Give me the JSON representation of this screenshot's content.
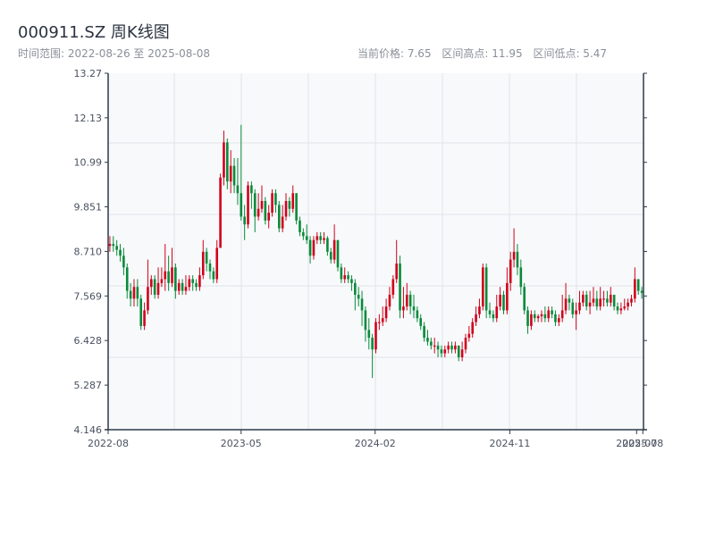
{
  "header": {
    "title": "000911.SZ 周K线图",
    "range_label": "时间范围: 2022-08-26 至 2025-08-08",
    "current_price": "当前价格: 7.65",
    "range_high": "区间高点: 11.95",
    "range_low": "区间低点: 5.47"
  },
  "chart_data": {
    "type": "candlestick",
    "title": "000911.SZ 周K线图",
    "start_date": "2022-08-26",
    "end_date": "2025-08-08",
    "ylim": [
      4.146,
      13.27
    ],
    "yticks": [
      "13.27",
      "12.13",
      "10.99",
      "9.851",
      "8.710",
      "7.569",
      "6.428",
      "5.287",
      "4.146"
    ],
    "xticks": [
      {
        "label": "2022-08",
        "week": 0
      },
      {
        "label": "2023-05",
        "week": 38.5
      },
      {
        "label": "2024-02",
        "week": 77.3
      },
      {
        "label": "2024-11",
        "week": 116.3
      },
      {
        "label": "2025-07",
        "week": 153
      },
      {
        "label": "2025-08",
        "week": 154.8
      }
    ],
    "colors": {
      "up": "#d0021b",
      "down": "#0a8a3a",
      "axis": "#2d3a4a",
      "grid": "#e1e4e8",
      "bg": "#f7f9fb"
    },
    "open": [
      8.85,
      8.9,
      8.85,
      8.75,
      8.6,
      8.3,
      7.7,
      7.5,
      7.8,
      7.5,
      6.8,
      7.2,
      7.8,
      8.0,
      7.6,
      7.9,
      8.0,
      8.2,
      7.9,
      8.3,
      7.7,
      7.9,
      7.7,
      7.8,
      8.0,
      7.9,
      7.8,
      8.1,
      8.7,
      8.4,
      8.2,
      8.0,
      8.8,
      10.6,
      11.5,
      10.5,
      10.9,
      10.4,
      10.2,
      9.6,
      9.4,
      10.4,
      10.2,
      9.6,
      9.8,
      10.0,
      9.5,
      9.7,
      10.2,
      9.9,
      9.3,
      9.6,
      10.0,
      9.8,
      10.2,
      9.5,
      9.2,
      9.1,
      9.0,
      8.6,
      9.0,
      9.1,
      9.0,
      9.05,
      8.7,
      8.5,
      9.0,
      8.3,
      8.0,
      8.1,
      8.0,
      7.9,
      7.6,
      7.5,
      7.2,
      6.7,
      6.5,
      6.2,
      6.9,
      6.9,
      7.0,
      7.3,
      7.6,
      8.0,
      8.4,
      7.2,
      7.3,
      7.6,
      7.3,
      7.2,
      7.0,
      6.8,
      6.5,
      6.4,
      6.3,
      6.3,
      6.2,
      6.1,
      6.2,
      6.3,
      6.2,
      6.3,
      6.0,
      6.2,
      6.5,
      6.6,
      6.9,
      7.1,
      7.3,
      8.3,
      7.2,
      7.1,
      7.0,
      7.3,
      7.6,
      7.2,
      7.9,
      8.5,
      8.7,
      8.3,
      7.8,
      7.2,
      6.8,
      7.1,
      7.0,
      7.05,
      7.1,
      7.0,
      7.2,
      7.1,
      6.9,
      7.0,
      7.2,
      7.5,
      7.4,
      7.1,
      7.2,
      7.4,
      7.6,
      7.3,
      7.4,
      7.5,
      7.3,
      7.5,
      7.5,
      7.4,
      7.6,
      7.3,
      7.2,
      7.25,
      7.3,
      7.4,
      7.5,
      8.0,
      7.7
    ],
    "close": [
      8.9,
      8.85,
      8.75,
      8.6,
      8.3,
      7.7,
      7.5,
      7.8,
      7.5,
      6.8,
      7.2,
      7.8,
      8.0,
      7.6,
      7.9,
      8.0,
      8.2,
      7.9,
      8.3,
      7.7,
      7.9,
      7.7,
      7.8,
      8.0,
      7.9,
      7.8,
      8.1,
      8.7,
      8.4,
      8.2,
      8.0,
      8.8,
      10.6,
      11.5,
      10.5,
      10.9,
      10.4,
      10.2,
      9.6,
      9.4,
      10.4,
      10.2,
      9.6,
      9.8,
      10.0,
      9.5,
      9.7,
      10.2,
      9.9,
      9.3,
      9.6,
      10.0,
      9.8,
      10.2,
      9.5,
      9.2,
      9.1,
      9.0,
      8.6,
      9.0,
      9.1,
      9.0,
      9.05,
      8.7,
      8.5,
      9.0,
      8.3,
      8.0,
      8.1,
      8.0,
      7.9,
      7.6,
      7.5,
      7.2,
      6.7,
      6.5,
      6.2,
      6.9,
      6.9,
      7.0,
      7.3,
      7.6,
      8.0,
      8.4,
      7.2,
      7.3,
      7.6,
      7.3,
      7.2,
      7.0,
      6.8,
      6.5,
      6.4,
      6.3,
      6.3,
      6.2,
      6.1,
      6.2,
      6.3,
      6.2,
      6.3,
      6.0,
      6.2,
      6.5,
      6.6,
      6.9,
      7.1,
      7.3,
      8.3,
      7.2,
      7.1,
      7.0,
      7.3,
      7.6,
      7.2,
      7.9,
      8.5,
      8.7,
      8.3,
      7.8,
      7.2,
      6.8,
      7.1,
      7.0,
      7.05,
      7.1,
      7.0,
      7.2,
      7.1,
      6.9,
      7.0,
      7.2,
      7.5,
      7.4,
      7.1,
      7.2,
      7.4,
      7.6,
      7.3,
      7.4,
      7.5,
      7.3,
      7.5,
      7.5,
      7.4,
      7.6,
      7.3,
      7.2,
      7.25,
      7.3,
      7.4,
      7.5,
      8.0,
      7.7,
      7.65
    ],
    "high": [
      9.1,
      9.1,
      9.0,
      8.9,
      8.8,
      8.4,
      7.9,
      8.0,
      8.0,
      7.6,
      7.4,
      8.5,
      8.1,
      8.1,
      8.3,
      8.3,
      8.9,
      8.6,
      8.8,
      8.4,
      8.0,
      8.0,
      8.1,
      8.1,
      8.1,
      8.0,
      8.3,
      9.0,
      8.8,
      8.5,
      8.3,
      9.0,
      10.7,
      11.8,
      11.6,
      11.3,
      11.1,
      11.1,
      11.95,
      9.9,
      10.5,
      10.5,
      10.3,
      10.2,
      10.4,
      10.1,
      9.9,
      10.3,
      10.3,
      10.0,
      9.9,
      10.2,
      10.1,
      10.4,
      10.2,
      9.6,
      9.3,
      9.4,
      9.1,
      9.1,
      9.2,
      9.2,
      9.2,
      9.1,
      8.8,
      9.4,
      9.0,
      8.4,
      8.3,
      8.2,
      8.1,
      8.0,
      7.8,
      7.7,
      7.3,
      7.0,
      6.6,
      7.0,
      7.1,
      7.3,
      7.5,
      7.8,
      8.1,
      9.0,
      8.6,
      7.8,
      7.9,
      7.7,
      7.6,
      7.3,
      7.1,
      6.9,
      6.7,
      6.5,
      6.5,
      6.4,
      6.3,
      6.3,
      6.4,
      6.4,
      6.4,
      6.3,
      6.4,
      6.6,
      6.8,
      7.0,
      7.3,
      7.5,
      8.4,
      8.4,
      7.4,
      7.2,
      7.6,
      7.8,
      7.7,
      8.3,
      8.7,
      9.3,
      8.9,
      8.5,
      7.9,
      7.3,
      7.2,
      7.2,
      7.1,
      7.2,
      7.3,
      7.3,
      7.3,
      7.2,
      7.1,
      7.6,
      7.9,
      7.6,
      7.5,
      7.4,
      7.7,
      7.7,
      7.7,
      7.7,
      7.8,
      7.7,
      7.8,
      7.7,
      7.7,
      7.8,
      7.6,
      7.4,
      7.4,
      7.5,
      7.5,
      7.6,
      8.3,
      8.0,
      7.8
    ],
    "low": [
      8.7,
      8.7,
      8.6,
      8.45,
      8.1,
      7.5,
      7.3,
      7.3,
      7.3,
      6.7,
      6.7,
      7.1,
      7.6,
      7.5,
      7.5,
      7.8,
      7.7,
      7.7,
      7.8,
      7.5,
      7.6,
      7.6,
      7.6,
      7.7,
      7.7,
      7.7,
      7.7,
      8.0,
      8.2,
      8.0,
      7.9,
      7.9,
      8.8,
      10.4,
      10.3,
      10.2,
      10.2,
      9.9,
      9.5,
      9.0,
      9.3,
      9.8,
      9.2,
      9.5,
      9.7,
      9.4,
      9.3,
      9.6,
      9.7,
      9.2,
      9.2,
      9.5,
      9.6,
      9.7,
      9.4,
      9.1,
      9.0,
      8.9,
      8.4,
      8.5,
      8.9,
      8.9,
      8.9,
      8.6,
      8.4,
      8.4,
      8.2,
      7.9,
      7.9,
      7.9,
      7.7,
      7.2,
      7.3,
      6.8,
      6.4,
      6.2,
      5.47,
      6.1,
      6.7,
      6.8,
      6.9,
      7.2,
      7.5,
      7.9,
      7.0,
      7.0,
      7.2,
      7.1,
      7.0,
      6.9,
      6.7,
      6.4,
      6.3,
      6.2,
      6.1,
      6.0,
      6.0,
      6.0,
      6.1,
      6.1,
      6.1,
      5.9,
      5.9,
      6.1,
      6.4,
      6.5,
      6.8,
      7.0,
      7.2,
      7.0,
      7.0,
      6.9,
      6.9,
      7.2,
      7.1,
      7.1,
      7.7,
      8.3,
      8.1,
      7.6,
      7.1,
      6.6,
      6.7,
      6.9,
      6.9,
      6.9,
      6.9,
      6.9,
      7.0,
      6.8,
      6.8,
      6.9,
      7.1,
      7.2,
      7.0,
      6.7,
      7.1,
      7.3,
      7.2,
      7.1,
      7.3,
      7.2,
      7.2,
      7.3,
      7.3,
      7.3,
      7.2,
      7.1,
      7.1,
      7.2,
      7.2,
      7.3,
      7.4,
      7.6,
      7.5
    ]
  }
}
